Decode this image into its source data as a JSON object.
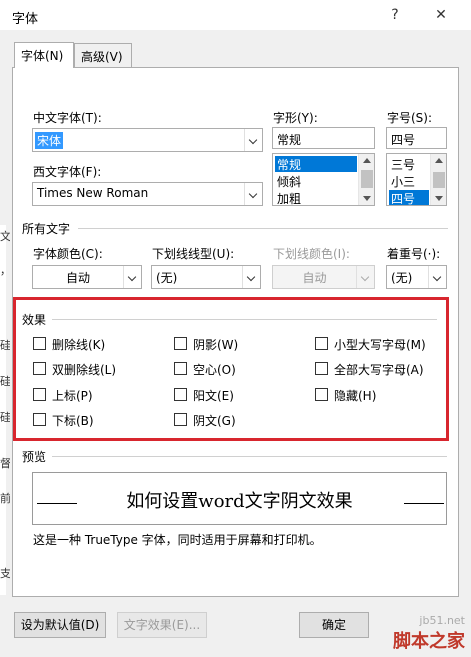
{
  "window": {
    "title": "字体",
    "help_glyph": "?",
    "close_glyph": "✕"
  },
  "tabs": [
    {
      "label": "字体(N)"
    },
    {
      "label": "高级(V)"
    }
  ],
  "left_strip_chars": [
    "文",
    "，",
    "硅",
    "硅",
    "硅",
    "督",
    "前",
    "支"
  ],
  "font": {
    "chinese_label": "中文字体(T):",
    "chinese_value": "宋体",
    "western_label": "西文字体(F):",
    "western_value": "Times New Roman",
    "style_label": "字形(Y):",
    "style_value": "常规",
    "style_options": [
      "常规",
      "倾斜",
      "加粗"
    ],
    "size_label": "字号(S):",
    "size_value": "四号",
    "size_options": [
      "三号",
      "小三",
      "四号"
    ]
  },
  "all_text": {
    "section_label": "所有文字",
    "color_label": "字体颜色(C):",
    "color_value": "自动",
    "underline_type_label": "下划线线型(U):",
    "underline_type_value": "(无)",
    "underline_color_label": "下划线颜色(I):",
    "underline_color_value": "自动",
    "emphasis_label": "着重号(·):",
    "emphasis_value": "(无)"
  },
  "effects": {
    "section_label": "效果",
    "items": [
      {
        "label": "删除线(K)",
        "checked": false
      },
      {
        "label": "双删除线(L)",
        "checked": false
      },
      {
        "label": "上标(P)",
        "checked": false
      },
      {
        "label": "下标(B)",
        "checked": false
      },
      {
        "label": "阴影(W)",
        "checked": false
      },
      {
        "label": "空心(O)",
        "checked": false
      },
      {
        "label": "阳文(E)",
        "checked": false
      },
      {
        "label": "阴文(G)",
        "checked": false
      },
      {
        "label": "小型大写字母(M)",
        "checked": false
      },
      {
        "label": "全部大写字母(A)",
        "checked": false
      },
      {
        "label": "隐藏(H)",
        "checked": false
      }
    ]
  },
  "preview": {
    "section_label": "预览",
    "sample_text": "如何设置word文字阴文效果",
    "note": "这是一种 TrueType 字体，同时适用于屏幕和打印机。"
  },
  "buttons": {
    "set_default": "设为默认值(D)",
    "text_effects": "文字效果(E)...",
    "ok": "确定"
  },
  "watermark": {
    "site": "jb51.net",
    "name": "脚本之家"
  },
  "colors": {
    "highlight_border": "#d8262e",
    "selection": "#0078d7",
    "dialog_bg": "#f0f0f0"
  }
}
